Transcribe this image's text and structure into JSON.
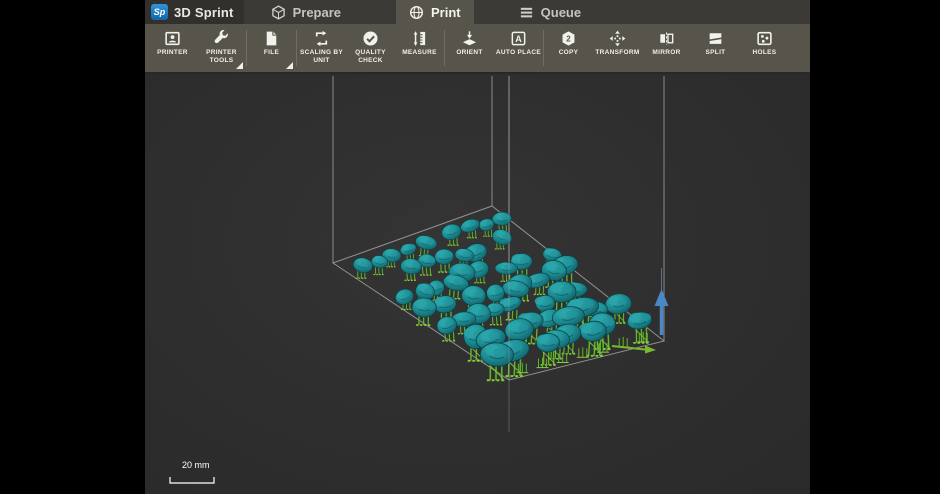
{
  "app": {
    "logo": "Sp",
    "title": "3D Sprint"
  },
  "tabs": [
    {
      "label": "Prepare",
      "icon": "cube",
      "active": false
    },
    {
      "label": "Print",
      "icon": "sphere",
      "active": true
    },
    {
      "label": "Queue",
      "icon": "menu",
      "active": false
    }
  ],
  "toolbar": {
    "items": [
      {
        "label": "PRINTER",
        "icon": "printer",
        "dropdown": false
      },
      {
        "label": "PRINTER TOOLS",
        "icon": "wrench",
        "dropdown": true
      },
      {
        "label": "FILE",
        "icon": "file",
        "dropdown": true
      },
      {
        "label": "SCALING BY UNIT",
        "icon": "scaling",
        "dropdown": false
      },
      {
        "label": "QUALITY CHECK",
        "icon": "quality",
        "dropdown": false
      },
      {
        "label": "MEASURE",
        "icon": "measure",
        "dropdown": false
      },
      {
        "label": "ORIENT",
        "icon": "orient",
        "dropdown": false
      },
      {
        "label": "AUTO PLACE",
        "icon": "autoplace",
        "dropdown": false
      },
      {
        "label": "COPY",
        "icon": "copy",
        "dropdown": false
      },
      {
        "label": "TRANSFORM",
        "icon": "transform",
        "dropdown": false
      },
      {
        "label": "MIRROR",
        "icon": "mirror",
        "dropdown": false
      },
      {
        "label": "SPLIT",
        "icon": "split",
        "dropdown": false
      },
      {
        "label": "HOLES",
        "icon": "holes",
        "dropdown": false
      }
    ]
  },
  "viewport": {
    "scale_label": "20 mm",
    "scene_colors": {
      "model_teal": "#1d8a90",
      "model_teal_light": "#2fb0b0",
      "model_teal_dark": "#0f5e68",
      "support_green": "#5eb52c",
      "support_green_light": "#86cc3a",
      "wireframe_gray": "#9b9b9b",
      "z_arrow_blue": "#4a87c7",
      "edge_arrow_green": "#79b92e",
      "background": "#2f2f2f"
    }
  },
  "colors": {
    "tabbar": "#3b3a37",
    "toolbar": "#57544b",
    "letterbox": "#000000"
  }
}
